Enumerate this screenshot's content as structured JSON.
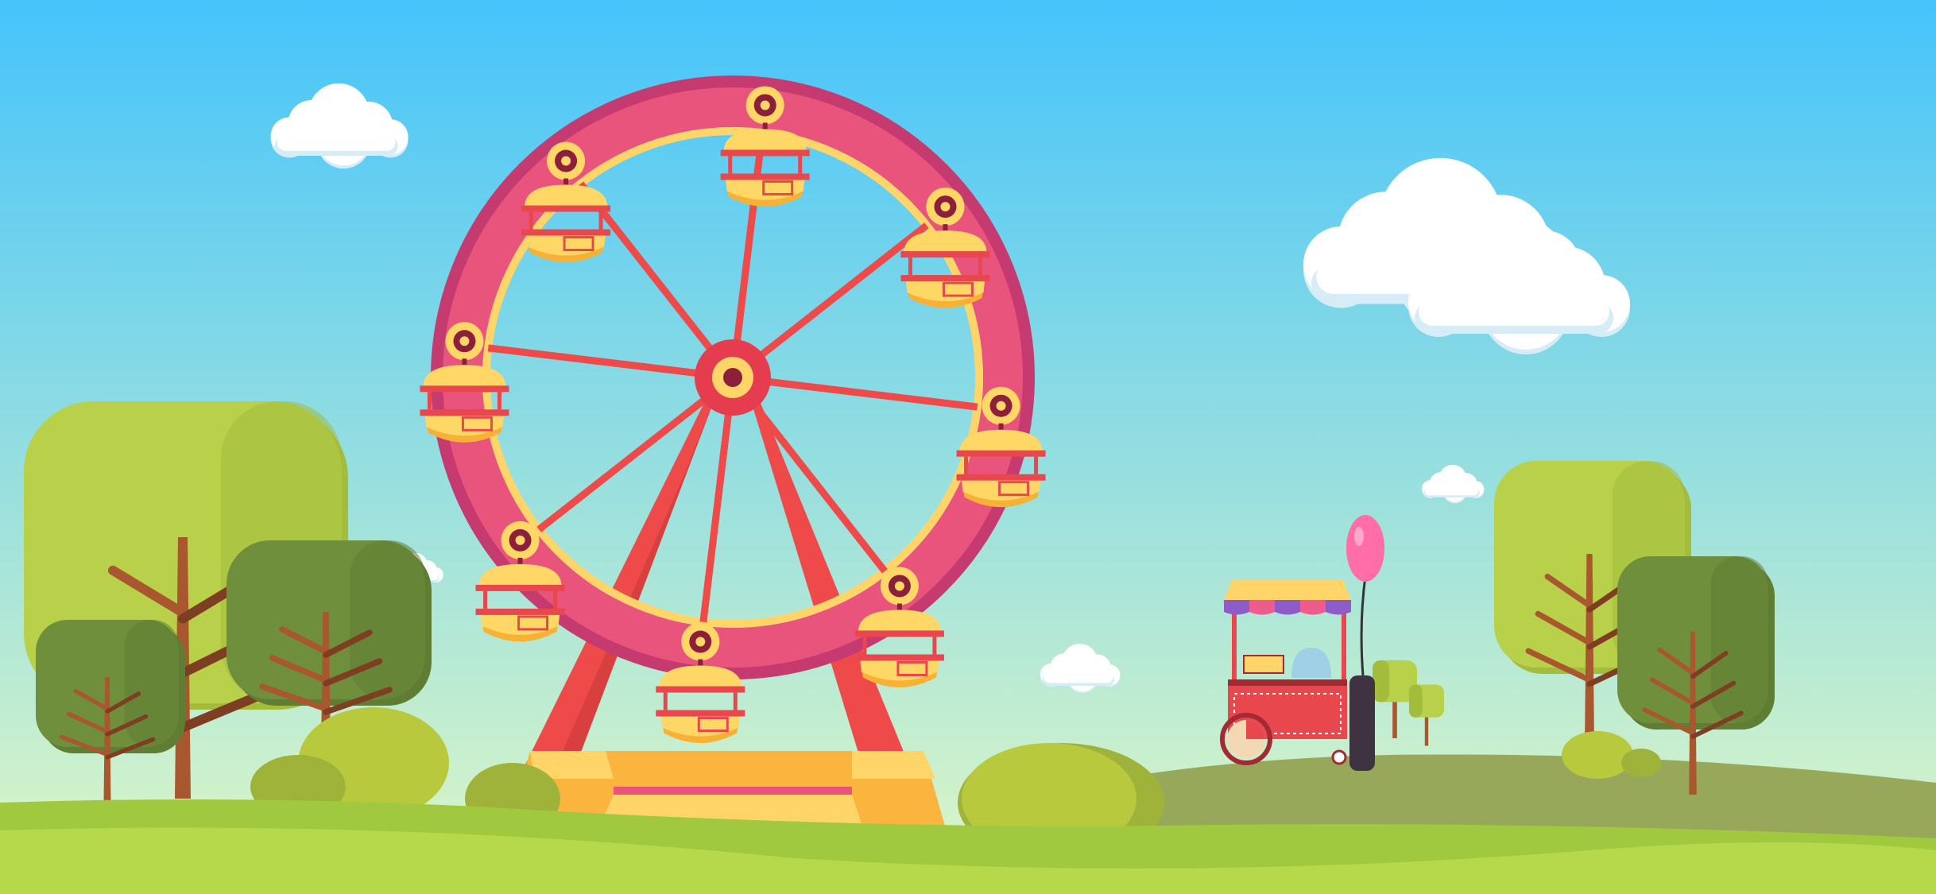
{
  "scene": {
    "description_tag": "amusement-park-illustration",
    "colors": {
      "sky_top": "#45c4fb",
      "sky_bottom": "#e0f7c6",
      "wheel_rim_outer": "#c63b6f",
      "wheel_rim_inner": "#e8547c",
      "wheel_inner_ring": "#ffd56a",
      "spoke": "#ef4a4a",
      "support": "#ef4a4a",
      "support_shadow": "#c23636",
      "hub": "#e63c4f",
      "hub_center": "#ffd56a",
      "cabin_top": "#ffd767",
      "cabin_shade": "#f7b236",
      "cabin_bar": "#e8484d",
      "cabin_ring": "#8c1f3a",
      "base_top": "#ffd56a",
      "base_front": "#fbb43e",
      "ground_front": "#b6d94b",
      "ground_mid": "#a0c93f",
      "hill_back": "#97a85a",
      "bush": "#b8c93e",
      "bush_dark": "#9fb33a",
      "tree_light": "#b9d14a",
      "tree_light_shade": "#a3bc3c",
      "tree_dark": "#6f8f3d",
      "tree_dark_shade": "#5f7d33",
      "trunk": "#a8572e",
      "trunk_dark": "#7e3e21",
      "cloud": "#ffffff",
      "cloud_shade": "#d6ecf7",
      "cart_red": "#e8484d",
      "cart_dark": "#a32a32",
      "awning_yellow": "#ffd56a",
      "awning_purple": "#8e5cc9",
      "awning_pink": "#ef5b8d",
      "balloon": "#ff6ea8",
      "balloon_string": "#333333",
      "gas_tank": "#3f3342",
      "wheel_cart": "#f3d9b3"
    },
    "icons": [
      "ferris-wheel-icon",
      "cloud-icon",
      "tree-icon",
      "bush-icon",
      "cart-icon",
      "balloon-icon"
    ]
  }
}
